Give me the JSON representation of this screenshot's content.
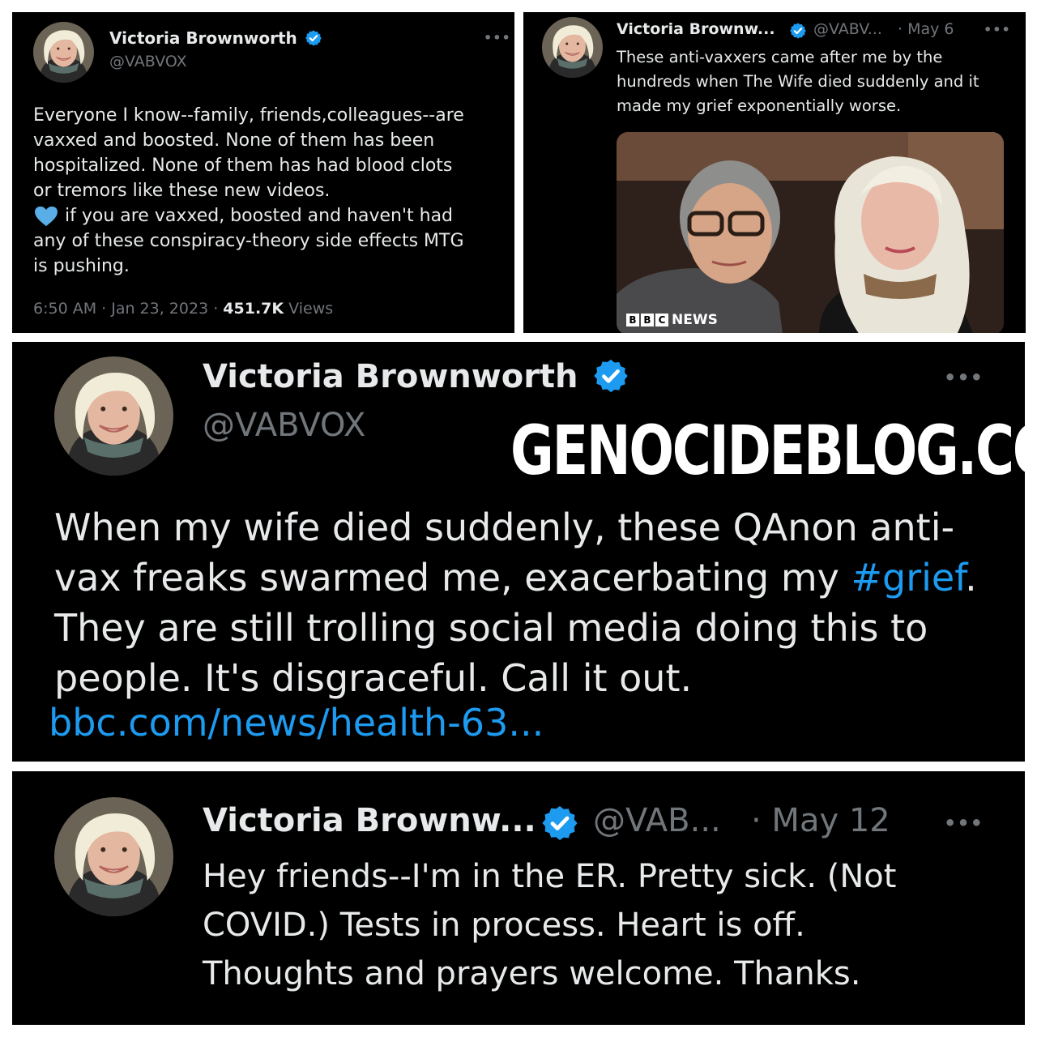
{
  "tweet1": {
    "name": "Victoria Brownworth",
    "handle": "@VABVOX",
    "line1": "Everyone I know--family, friends,colleagues--are",
    "line2": "vaxxed and boosted. None of them has been",
    "line3": "hospitalized. None of them has had blood clots",
    "line4": "or tremors like these new videos.",
    "line5": " if you are vaxxed, boosted and haven't had",
    "line6": "any of these conspiracy-theory side effects MTG",
    "line7": "is pushing.",
    "timestamp": "6:50 AM · Jan 23, 2023 · ",
    "views_count": "451.7K",
    "views_label": " Views"
  },
  "tweet2": {
    "name": "Victoria Brownw...",
    "handle": "@VABV...",
    "date": "· May 6",
    "line1": "These anti-vaxxers came after me by the",
    "line2": "hundreds when The Wife died suddenly and it",
    "line3": "made my grief exponentially worse.",
    "photo_logo_letters": [
      "B",
      "B",
      "C"
    ],
    "photo_logo_word": "NEWS"
  },
  "tweet3": {
    "name": "Victoria Brownworth",
    "handle": "@VABVOX",
    "watermark": "GENOCIDEBLOG.COM",
    "line1": "When my wife died suddenly, these QAnon anti-",
    "line2_pre": "vax freaks swarmed me, exacerbating my ",
    "line2_tag": "#grief",
    "line2_post": ".",
    "line3": "They are still trolling social media doing this to",
    "line4": "people. It's disgraceful. Call it out.",
    "link": "bbc.com/news/health-63..."
  },
  "tweet4": {
    "name": "Victoria Brownw...",
    "handle": "@VAB...",
    "date": "· May 12",
    "line1": "Hey friends--I'm in the ER.  Pretty sick. (Not",
    "line2": "COVID.) Tests in process. Heart is off.",
    "line3": "Thoughts and prayers welcome. Thanks."
  },
  "icons": [
    "verified-badge-icon",
    "more-options-icon",
    "blue-heart-icon"
  ],
  "colors": {
    "background": "#000000",
    "text": "#e7e9ea",
    "muted": "#71767b",
    "link": "#1d9bf0",
    "verified": "#1d9bf0",
    "frame": "#ffffff"
  }
}
